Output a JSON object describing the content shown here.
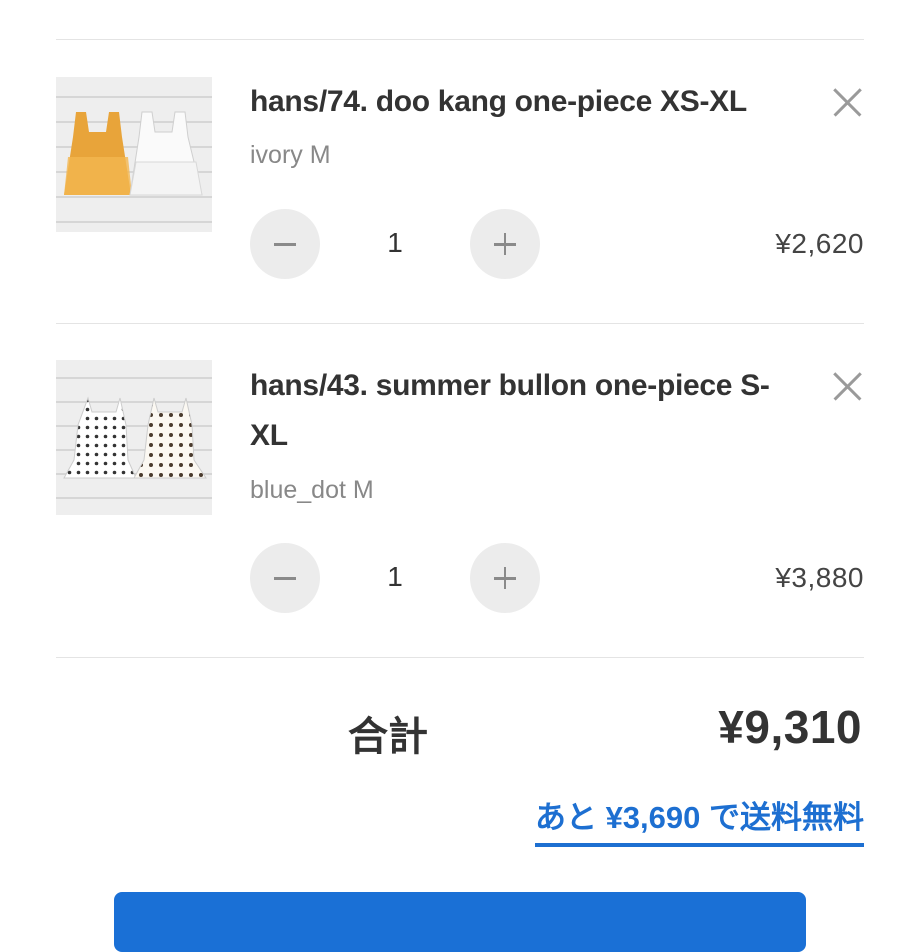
{
  "cart": {
    "items": [
      {
        "title": "hans/74. doo kang one-piece XS-XL",
        "variant": "ivory M",
        "quantity": "1",
        "price": "¥2,620",
        "thumbnail": "orange-and-white-sleeveless-dresses"
      },
      {
        "title": "hans/43. summer bullon one-piece S-XL",
        "variant": "blue_dot M",
        "quantity": "1",
        "price": "¥3,880",
        "thumbnail": "polka-dot-sleeveless-dresses"
      }
    ],
    "total_label": "合計",
    "total_value": "¥9,310",
    "free_shipping_note": "あと ¥3,690 で送料無料"
  },
  "colors": {
    "accent": "#1a70d6",
    "link": "#1d6fd1",
    "text": "#333333",
    "muted": "#888888",
    "stepper_bg": "#ececec"
  },
  "icons": {
    "remove": "close-icon",
    "decrement": "minus-icon",
    "increment": "plus-icon"
  }
}
